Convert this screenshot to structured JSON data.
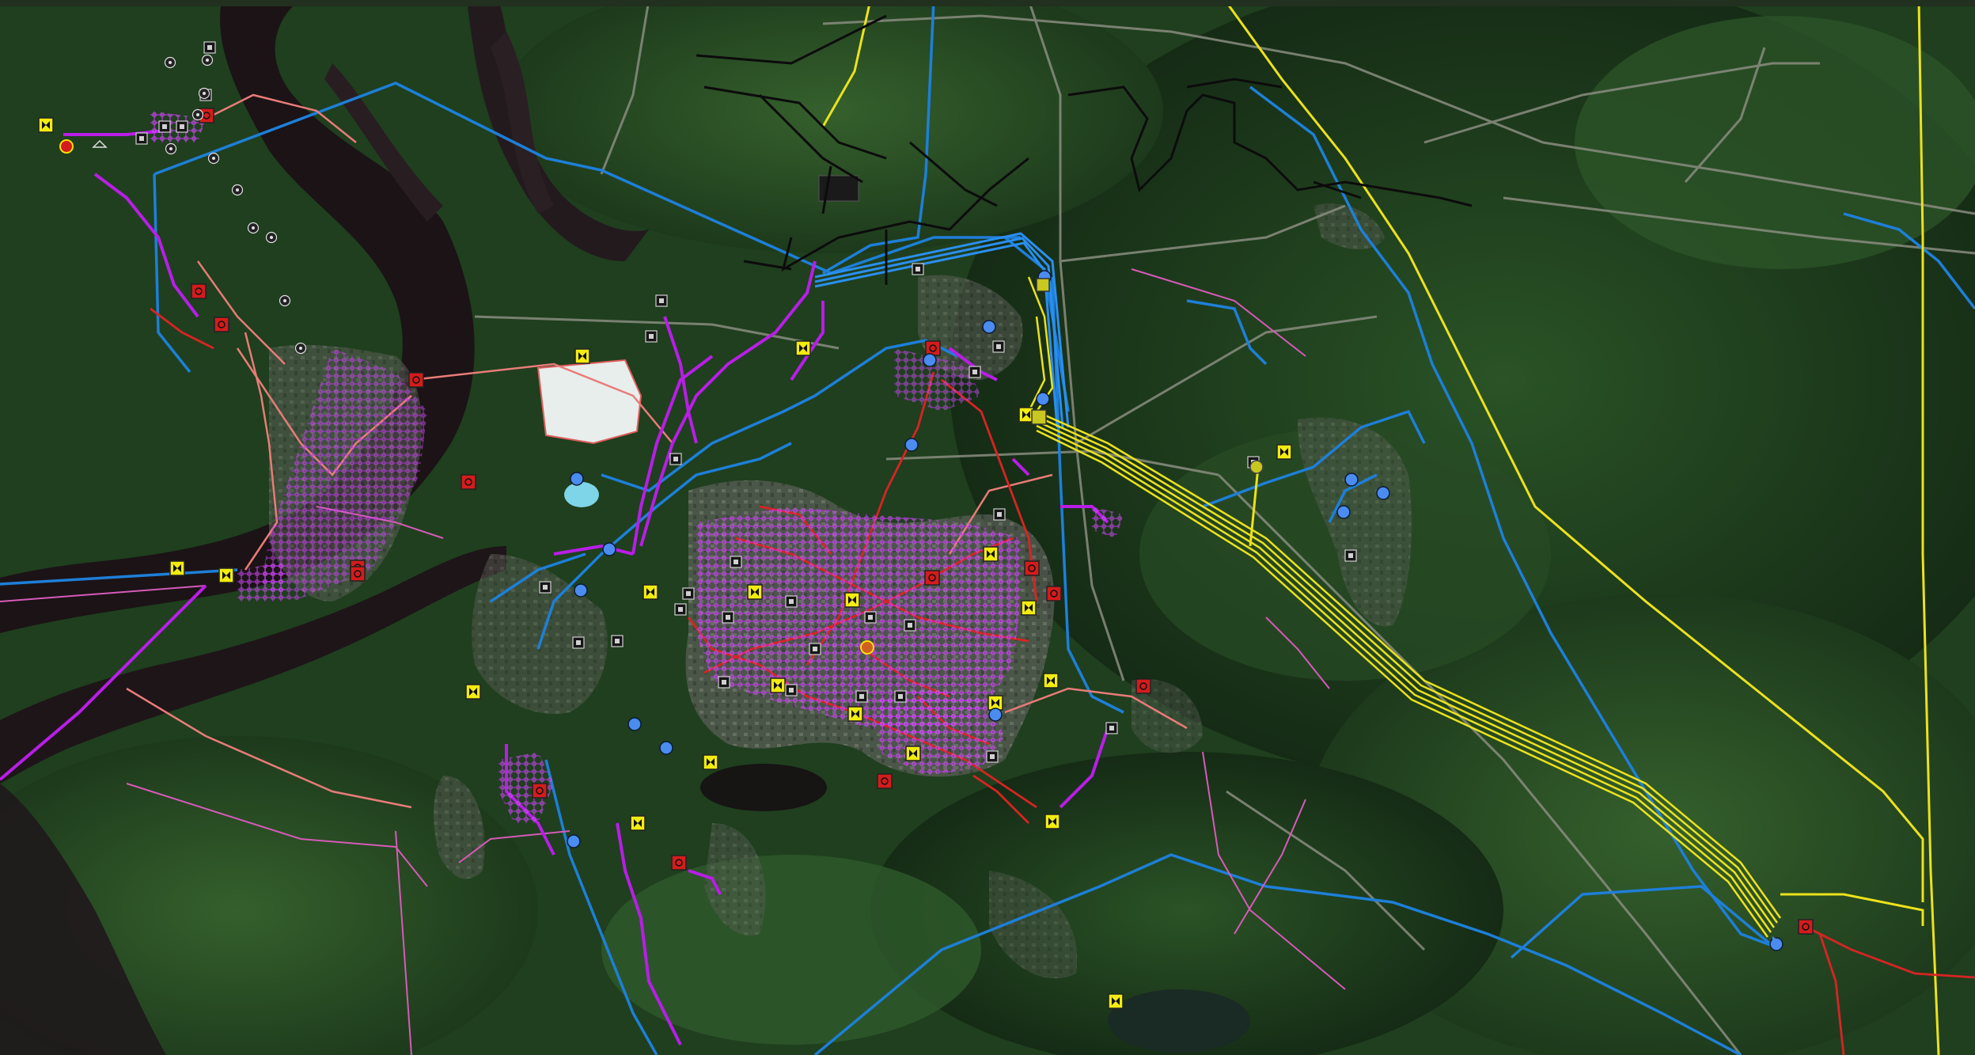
{
  "map": {
    "basemap": "satellite",
    "colors": {
      "forest_dark": "#163017",
      "forest": "#274d24",
      "river": "#1c1416",
      "river_light": "#2a2228",
      "urban": "#5e6259",
      "line_blue": "#1e7fd8",
      "line_yellow": "#ece21c",
      "line_magenta": "#b81ee6",
      "line_red": "#d82424",
      "line_pink": "#e84ca6",
      "line_orange": "#e8a060",
      "line_black": "#0c0c0c",
      "line_salmon": "#e87c78",
      "marker_yellow": "#f2ec10",
      "marker_red": "#d41c1c",
      "marker_blue": "#4a8cf0",
      "marker_dark": "#161616"
    },
    "layers": [
      {
        "name": "power-lines-blue",
        "color_key": "line_blue"
      },
      {
        "name": "power-lines-yellow",
        "color_key": "line_yellow"
      },
      {
        "name": "power-lines-magenta",
        "color_key": "line_magenta"
      },
      {
        "name": "power-lines-red",
        "color_key": "line_red"
      },
      {
        "name": "power-lines-pink",
        "color_key": "line_pink"
      },
      {
        "name": "power-lines-black",
        "color_key": "line_black"
      }
    ],
    "marker_icons": [
      "substation-icon",
      "transformer-icon",
      "switch-icon",
      "breaker-icon",
      "plant-icon"
    ]
  }
}
